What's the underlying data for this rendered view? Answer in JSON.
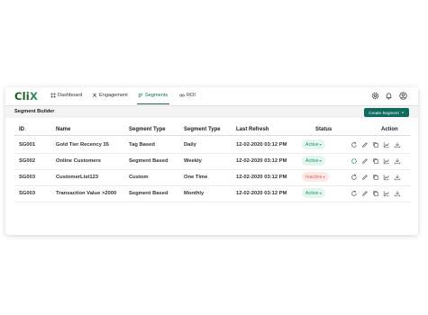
{
  "app": {
    "logo": "Cli",
    "logo_accent": "X"
  },
  "nav": {
    "items": [
      {
        "label": "Dashboard",
        "icon": "grid-icon"
      },
      {
        "label": "Engagement",
        "icon": "network-icon"
      },
      {
        "label": "Segments",
        "icon": "segments-icon",
        "active": true
      },
      {
        "label": "ROI",
        "icon": "link-icon"
      }
    ],
    "right_icons": [
      "gear-icon",
      "bell-icon",
      "user-icon"
    ]
  },
  "subheader": {
    "title": "Segment Builder",
    "create_button": "Create Segment"
  },
  "table": {
    "headers": {
      "id": "ID",
      "id_sort": "↓",
      "name": "Name",
      "segment_type": "Segment Type",
      "segment_type2": "Segment Type",
      "last_refresh": "Last Refresh",
      "status": "Status",
      "action": "Action"
    },
    "rows": [
      {
        "id": "SG001",
        "name": "Gold Tier Recency 35",
        "type": "Tag Based",
        "type2": "Daily",
        "refresh": "12-02-2020  03:12 PM",
        "status": "Active",
        "status_kind": "active"
      },
      {
        "id": "SG002",
        "name": "Online Customers",
        "type": "Segment Based",
        "type2": "Weekly",
        "refresh": "12-02-2020  03:12 PM",
        "status": "Active",
        "status_kind": "active"
      },
      {
        "id": "SG003",
        "name": "CustomerList123",
        "type": "Custom",
        "type2": "One Time",
        "refresh": "12-02-2020  03:12 PM",
        "status": "Inactive",
        "status_kind": "inactive"
      },
      {
        "id": "SG003",
        "name": "Transaction Value >2000",
        "type": "Segment Based",
        "type2": "Monthly",
        "refresh": "12-02-2020  03:12 PM",
        "status": "Active",
        "status_kind": "active"
      }
    ],
    "action_icons": [
      "refresh-icon",
      "edit-icon",
      "copy-icon",
      "chart-icon",
      "download-icon"
    ]
  },
  "colors": {
    "brand": "#0e6b5e",
    "active_text": "#1a9a6a",
    "inactive_text": "#e06055"
  }
}
